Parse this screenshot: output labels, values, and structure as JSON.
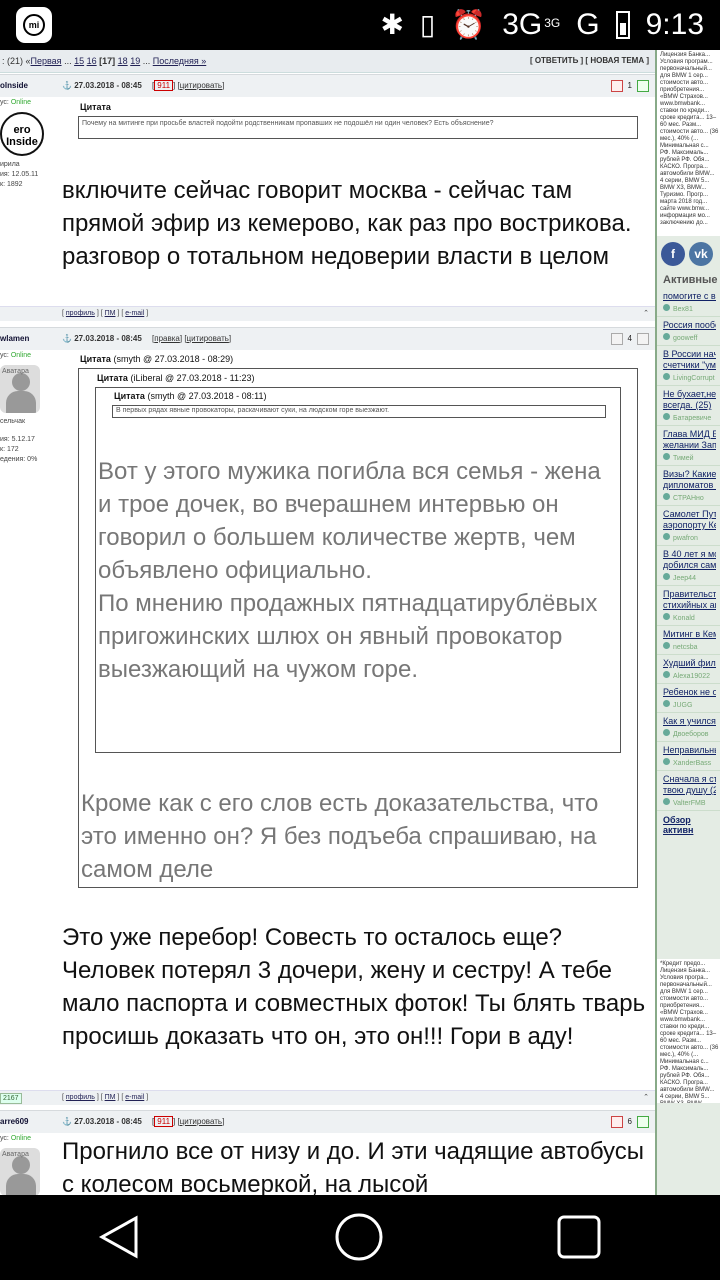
{
  "status_bar": {
    "network": "3G",
    "network_sup": "3G",
    "signal2": "G",
    "time": "9:13"
  },
  "pager": {
    "prefix": ": (21) «",
    "first": "Первая",
    "pages": [
      "15",
      "16",
      "[17]",
      "18",
      "19"
    ],
    "last": "Последняя »",
    "actions": "[ ОТВЕТИТЬ ] [ НОВАЯ ТЕМА ]"
  },
  "posts": [
    {
      "nick": "olnside",
      "status": "Online",
      "status_prefix": "ус:",
      "avatar_text": "ero Inside",
      "info": [
        "ирила",
        "ия: 12.05.11",
        "к: 1892"
      ],
      "date": "27.03.2018 - 08:45",
      "badge": "911",
      "cite": "цитировать",
      "rating": "1",
      "quote_label": "Цитата",
      "quote_text": "Почему на митинге при просьбе властей подойти родственникам пропавших не подошёл ни один человек? Есть объяснение?",
      "body": "включите сейчас говорит москва - сейчас там прямой эфир из кемерово, как раз про вострикова. разговор о тотальном недоверии власти в целом",
      "footer_links": [
        "профиль",
        "ПМ",
        "e-mail"
      ]
    },
    {
      "nick": "wlamen",
      "status": "Online",
      "status_prefix": "ус:",
      "avatar_label": "Аватара",
      "info": [
        "сельчак",
        "ия: 5.12.17",
        "к: 172",
        "едения: 0%"
      ],
      "date": "27.03.2018 - 08:45",
      "edit": "правка",
      "cite": "цитировать",
      "rating": "4",
      "q1_label": "Цитата",
      "q1_sub": "(smyth @ 27.03.2018 - 08:29)",
      "q2_label": "Цитата",
      "q2_sub": "(iLiberal @ 27.03.2018 - 11:23)",
      "q3_label": "Цитата",
      "q3_sub": "(smyth @ 27.03.2018 - 08:11)",
      "q3_text": "В первых рядах явные провокаторы, раскачивают суки, на людском горе выезжают.",
      "q2_body": "Вот у этого мужика погибла вся семья - жена и трое дочек, во вчерашнем интервью он говорил о большем количестве жертв, чем объявлено официально.\nПо мнению продажных пятнадцатирублёвых пригожинских шлюх он явный провокатор выезжающий на чужом горе.",
      "q1_body": "Кроме как с его слов есть доказательства, что это именно он? Я без подъеба спрашиваю, на самом деле",
      "body": "Это уже перебор! Совесть то осталось еще? Человек потерял 3 дочери, жену и сестру! А тебе мало паспорта и совместных фоток! Ты блять тварь просишь доказать что он, это он!!! Гори в аду!",
      "footer_links": [
        "профиль",
        "ПМ",
        "e-mail"
      ],
      "rep": "2167"
    },
    {
      "nick": "arre609",
      "status": "Online",
      "status_prefix": "ус:",
      "avatar_label": "Аватара",
      "date": "27.03.2018 - 08:45",
      "badge": "911",
      "cite": "цитировать",
      "rating": "6",
      "body": "Прогнило все от низу и до. И эти чадящие автобусы с колесом восьмеркой, на лысой"
    }
  ],
  "sidebar": {
    "ad_top": "Лицензия Банка... Условия програм... первоначальный... для BMW 1 сер... стоимости авто... приобретения... «BMW Страхов... www.bmwbank... ставки по креди... сроке кредита... 13–60 мес. Разм... стоимости авто... (36 мес.), 40% (... Минимальная с... РФ. Максималь... рублей РФ. Обя... КАСКО. Програ... автомобили BMW... 4 серии, BMW 5... BMW X3, BMW... Туризмо. Прогр... марта 2018 год... сайте www.bmw... информация мо... заключению до...",
    "social": [
      "f",
      "vk"
    ],
    "active_title": "Активные",
    "active_items": [
      {
        "title": "помогите с вы",
        "user": "Bex81"
      },
      {
        "title": "Россия пообе",
        "user": "gooweff"
      },
      {
        "title": "В России нача",
        "title2": "счетчики \"умн",
        "user": "LivingCorrupt"
      },
      {
        "title": "Не бухает,не к",
        "title2": "всегда. (25)",
        "user": "Батаревиче"
      },
      {
        "title": "Глава МИД Бр",
        "title2": "желании Запа",
        "user": "Тимей"
      },
      {
        "title": "Визы? Какие в",
        "title2": "дипломатов о",
        "user": "СТРАНно"
      },
      {
        "title": "Самолет Пути",
        "title2": "аэропорту Кем",
        "user": "pwafron"
      },
      {
        "title": "В 40 лет я мо",
        "title2": "добился сам (",
        "user": "Jeep44"
      },
      {
        "title": "Правительств",
        "title2": "стихийных ак",
        "user": "Konald"
      },
      {
        "title": "Митинг в Кем",
        "user": "netcsba"
      },
      {
        "title": "Худший фильм",
        "user": "Alexa19022"
      },
      {
        "title": "Ребенок не от",
        "user": "JUGG"
      },
      {
        "title": "Как я учился З",
        "user": "Двоеборов"
      },
      {
        "title": "Неправильны",
        "user": "XanderBass"
      },
      {
        "title": "Сначала я съе",
        "title2": "твою душу (21",
        "user": "ValterFMB"
      }
    ],
    "review": "Обзор активн",
    "ad_bottom": "*Кредит предо... Лицензия Банка... Условия програ... первоначальный... для BMW 1 сер... стоимости авто... приобретения... «BMW Страхов... www.bmwbank... ставки по креди... сроке кредита... 13–60 мес. Разм... стоимости авто... (36 мес.), 40% (... Минимальная с... РФ. Максималь... рублей РФ. Обя... КАСКО. Програ... автомобили BMW... 4 серии, BMW 5... BMW X3, BMW..."
  }
}
